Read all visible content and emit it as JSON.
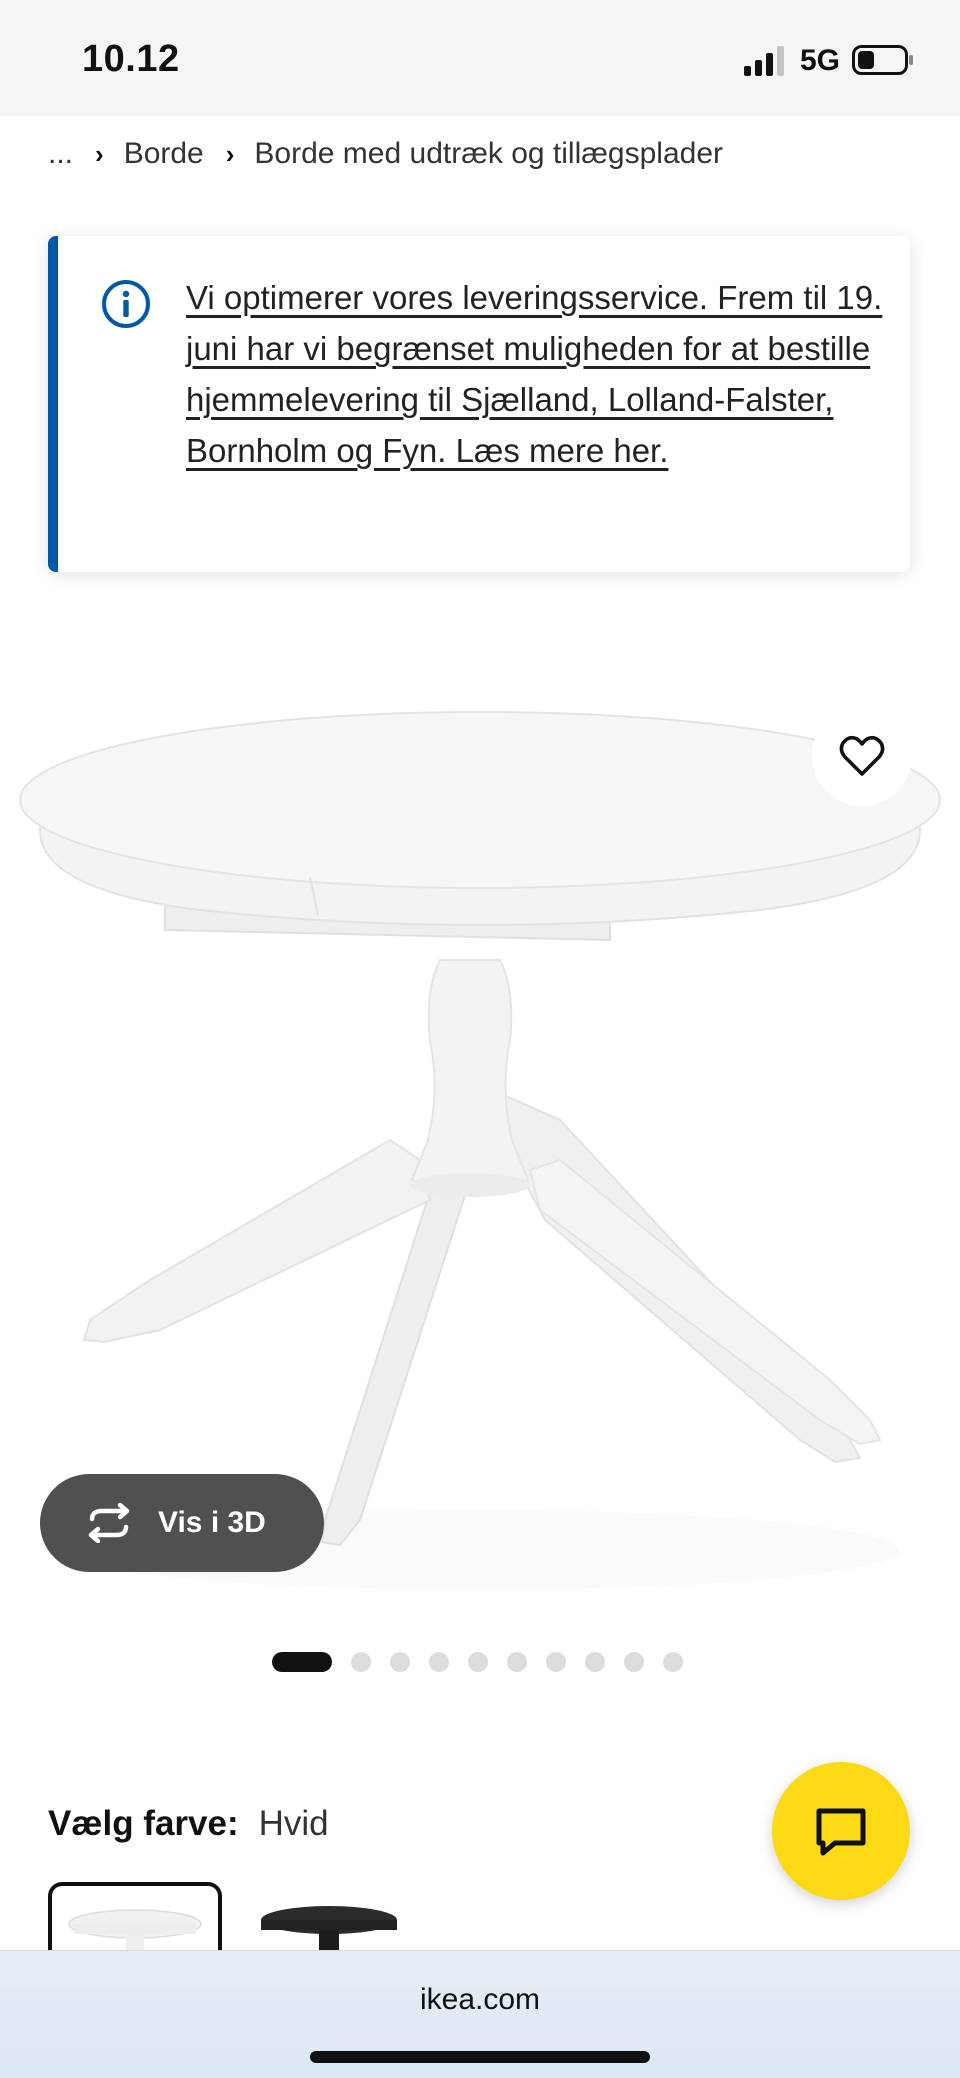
{
  "status_bar": {
    "time": "10.12",
    "network": "5G"
  },
  "breadcrumb": {
    "items": [
      "...",
      "Borde",
      "Borde med udtræk og tillægsplader"
    ]
  },
  "notice": {
    "text": "Vi optimerer vores leveringsservice. Frem til 19. juni har vi begrænset muligheden for at bestille hjemmelevering til Sjælland, Lolland-Falster, Bornholm og Fyn. Læs mere her.",
    "accent_color": "#0058a3",
    "icon": "info-icon"
  },
  "product_gallery": {
    "view3d_label": "Vis i 3D",
    "image_count": 10,
    "active_image_index": 0,
    "favorite_icon": "heart-icon"
  },
  "color_select": {
    "label": "Vælg farve:",
    "value": "Hvid",
    "options": [
      "white",
      "black"
    ]
  },
  "chat_fab": {
    "icon": "chat-bubble-icon",
    "color": "#fbd914"
  },
  "browser": {
    "url": "ikea.com"
  }
}
